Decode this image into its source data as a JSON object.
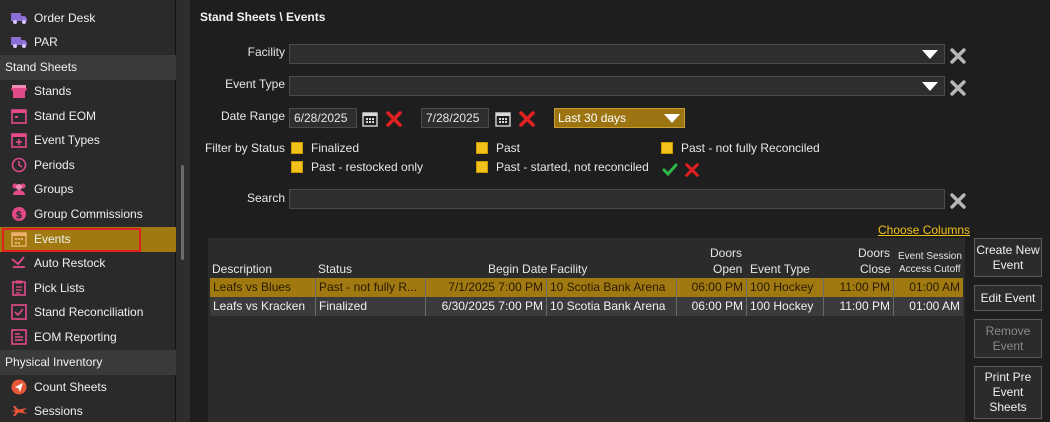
{
  "sidebar": {
    "items": [
      {
        "label": "Order Desk",
        "icon": "truck-icon",
        "type": "item"
      },
      {
        "label": "PAR",
        "icon": "truck-icon",
        "type": "item"
      },
      {
        "label": "Stand Sheets",
        "type": "header"
      },
      {
        "label": "Stands",
        "icon": "stand-icon",
        "type": "item"
      },
      {
        "label": "Stand EOM",
        "icon": "calendar-icon",
        "type": "item"
      },
      {
        "label": "Event Types",
        "icon": "calendar-plus-icon",
        "type": "item"
      },
      {
        "label": "Periods",
        "icon": "clock-icon",
        "type": "item"
      },
      {
        "label": "Groups",
        "icon": "users-icon",
        "type": "item"
      },
      {
        "label": "Group Commissions",
        "icon": "dollar-icon",
        "type": "item"
      },
      {
        "label": "Events",
        "icon": "calendar-grid-icon",
        "type": "item",
        "selected": true
      },
      {
        "label": "Auto Restock",
        "icon": "restock-icon",
        "type": "item"
      },
      {
        "label": "Pick Lists",
        "icon": "clipboard-icon",
        "type": "item"
      },
      {
        "label": "Stand Reconciliation",
        "icon": "reconcile-icon",
        "type": "item"
      },
      {
        "label": "EOM Reporting",
        "icon": "report-icon",
        "type": "item"
      },
      {
        "label": "Physical Inventory",
        "type": "header"
      },
      {
        "label": "Count Sheets",
        "icon": "send-icon",
        "type": "item"
      },
      {
        "label": "Sessions",
        "icon": "plane-icon",
        "type": "item"
      }
    ]
  },
  "header": {
    "title": "Stand Sheets \\ Events"
  },
  "filters": {
    "facility_label": "Facility",
    "facility_value": "",
    "event_type_label": "Event Type",
    "event_type_value": "",
    "date_range_label": "Date Range",
    "date_from": "6/28/2025",
    "date_to": "7/28/2025",
    "range_preset": "Last 30 days",
    "status_label": "Filter by Status",
    "statuses": [
      "Finalized",
      "Past",
      "Past - not fully Reconciled",
      "Past - restocked only",
      "Past - started, not reconciled"
    ],
    "search_label": "Search",
    "search_value": ""
  },
  "choose_columns": "Choose Columns",
  "grid": {
    "columns": [
      {
        "line1": "",
        "line2": "Description"
      },
      {
        "line1": "",
        "line2": "Status"
      },
      {
        "line1": "",
        "line2": "Begin Date"
      },
      {
        "line1": "",
        "line2": "Facility"
      },
      {
        "line1": "Doors",
        "line2": "Open"
      },
      {
        "line1": "",
        "line2": "Event Type"
      },
      {
        "line1": "Doors",
        "line2": "Close"
      },
      {
        "line1": "Event Session",
        "line2": "Access Cutoff"
      }
    ],
    "rows": [
      {
        "description": "Leafs vs Blues",
        "status": "Past - not fully R...",
        "begin": "7/1/2025 7:00 PM",
        "facility": "10 Scotia Bank Arena",
        "open": "06:00 PM",
        "type": "100 Hockey",
        "close": "11:00 PM",
        "cutoff": "01:00 AM",
        "selected": true
      },
      {
        "description": "Leafs vs Kracken",
        "status": "Finalized",
        "begin": "6/30/2025 7:00 PM",
        "facility": "10 Scotia Bank Arena",
        "open": "06:00 PM",
        "type": "100 Hockey",
        "close": "11:00 PM",
        "cutoff": "01:00 AM",
        "selected": false
      }
    ]
  },
  "buttons": {
    "create": "Create New Event",
    "edit": "Edit Event",
    "remove": "Remove Event",
    "print": "Print Pre Event Sheets"
  },
  "colors": {
    "accent": "#a07a10",
    "checkbox": "#f2c21b",
    "error": "#e02020",
    "ok": "#2fb84a"
  }
}
